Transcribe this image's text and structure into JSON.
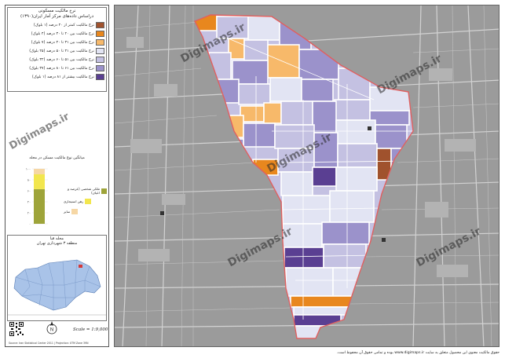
{
  "legend": {
    "title_line1": "نرخ مالکیت مسکونی",
    "title_line2": "دراساس داده‌های مرکز آمار ایران(۱۳۹۰)",
    "items": [
      {
        "label": "نرخ مالکیت کمتر از ۲۰ درصد (۱ بلوک)",
        "color": "#a0522d"
      },
      {
        "label": "نرخ مالکیت بین ۲۰ تا ۳۰ درصد (۴ بلوک)",
        "color": "#e8871e"
      },
      {
        "label": "نرخ مالکیت بین ۳۱ تا ۴۰ درصد (۷ بلوک)",
        "color": "#f7b96a"
      },
      {
        "label": "نرخ مالکیت بین ۴۱ تا ۵۰ درصد (۲۵ بلوک)",
        "color": "#e2e4f3"
      },
      {
        "label": "نرخ مالکیت بین ۵۱ تا ۶۰ درصد (۳۲ بلوک)",
        "color": "#c4c1e2"
      },
      {
        "label": "نرخ مالکیت بین ۶۱ تا ۸۰ درصد (۳۷ بلوک)",
        "color": "#9b92cb"
      },
      {
        "label": "نرخ مالکیت بیشتر از ۸۱ درصد (۱ بلوک)",
        "color": "#5a3f92"
      }
    ]
  },
  "chart": {
    "title": "میانگین نوع مالکیت مسکن در محله",
    "ticks": [
      "۱۰۰",
      "۸۰",
      "۶۰",
      "۴۰",
      "۲۰",
      "۰"
    ],
    "legend": [
      {
        "label": "ملکی شخصی (عرصه و اعیان)",
        "color": "#9ea43a"
      },
      {
        "label": "رهن استیجاری",
        "color": "#f2e64e"
      },
      {
        "label": "سایر",
        "color": "#f6d7a5"
      }
    ]
  },
  "chart_data": {
    "type": "bar",
    "categories": [
      ""
    ],
    "series": [
      {
        "name": "ملکی شخصی (عرصه و اعیان)",
        "values": [
          63
        ]
      },
      {
        "name": "رهن استیجاری",
        "values": [
          27
        ]
      },
      {
        "name": "سایر",
        "values": [
          10
        ]
      }
    ],
    "ylim": [
      0,
      100
    ],
    "stacked": true
  },
  "location": {
    "title_line1": "محله قبا",
    "title_line2": "منطقه ۳ شهرداری تهران"
  },
  "scale_text": "Scale = 1:9,000",
  "credit": "Source: Iran Statistical Center 2011 | Projection: UTM Zone 39N",
  "watermark": "Digimaps.ir",
  "footer": "حقوق مالکیت معنوی این محصول متعلق به سایت www.digimaps.ir بوده و تمامی حقوق آن محفوظ است.",
  "colors": {
    "map_bg": "#9a9a9a",
    "boundary": "#e06060"
  }
}
